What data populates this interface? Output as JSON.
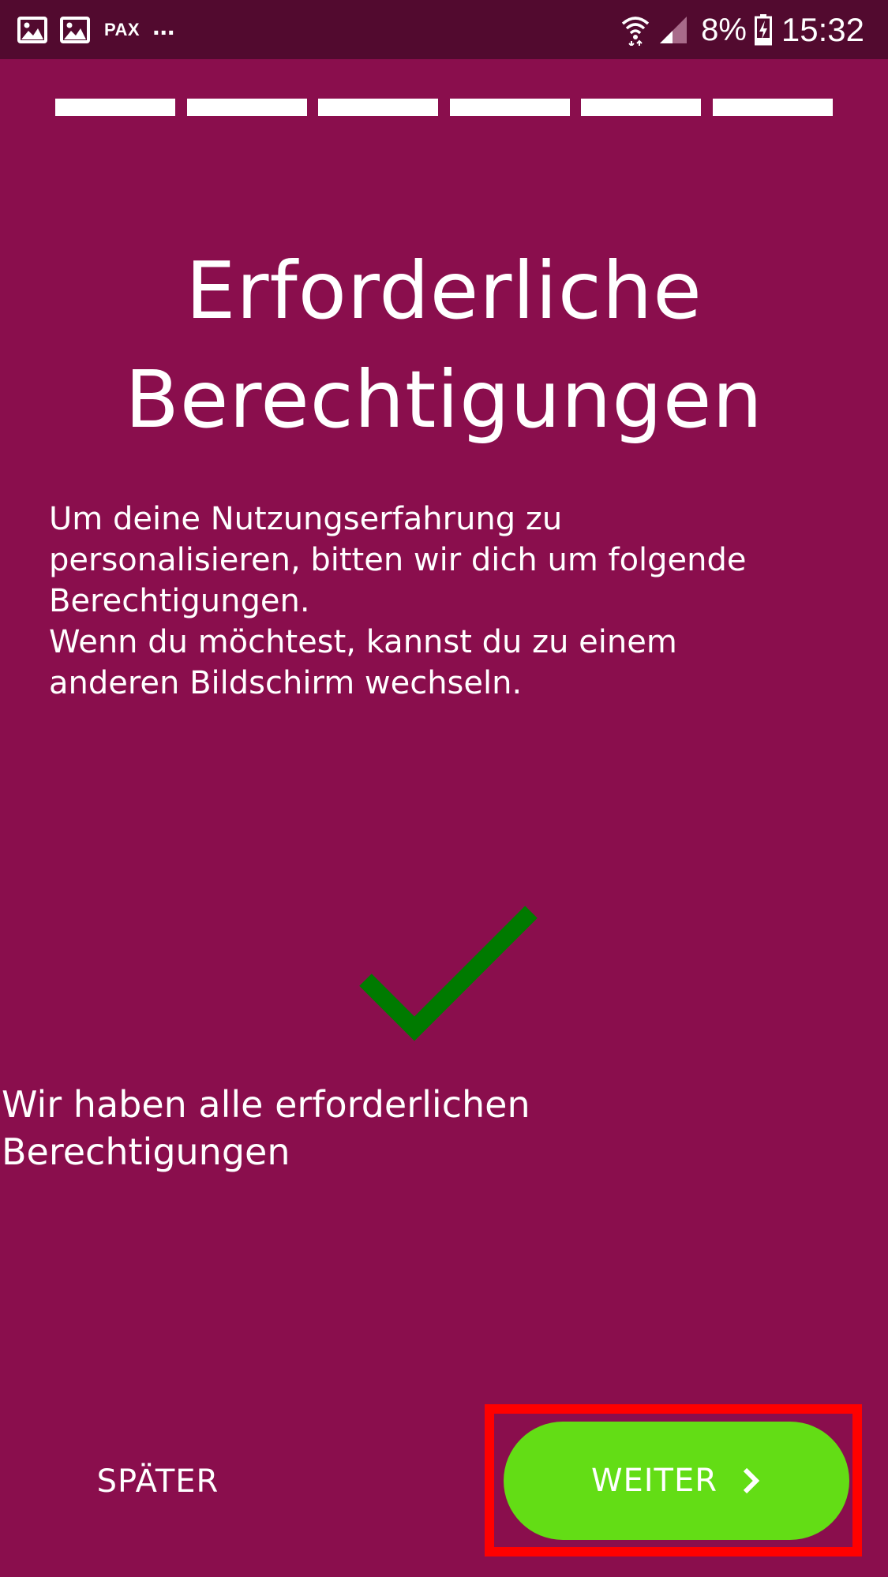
{
  "status_bar": {
    "carrier_label": "PAX",
    "overflow": "...",
    "battery_percent": "8%",
    "time": "15:32",
    "icons": [
      "image-icon",
      "image-icon",
      "wifi-icon",
      "signal-icon",
      "battery-charging-icon"
    ]
  },
  "onboarding": {
    "total_steps": 6,
    "completed_steps": 6
  },
  "title": {
    "line1": "Erforderliche",
    "line2": "Berechtigungen"
  },
  "description": {
    "line1": "Um deine Nutzungserfahrung zu",
    "line2": "personalisieren, bitten wir dich um folgende",
    "line3": "Berechtigungen.",
    "line4": "Wenn du möchtest, kannst du zu einem",
    "line5": "anderen Bildschirm wechseln."
  },
  "status": {
    "icon": "checkmark-icon",
    "line1": "Wir haben alle erforderlichen",
    "line2": "Berechtigungen"
  },
  "actions": {
    "later_label": "SPÄTER",
    "next_label": "WEITER"
  },
  "colors": {
    "background": "#8a0e4d",
    "status_bar": "#520a2f",
    "check": "#007a00",
    "next_button": "#63dd15",
    "highlight": "#ff0000"
  }
}
